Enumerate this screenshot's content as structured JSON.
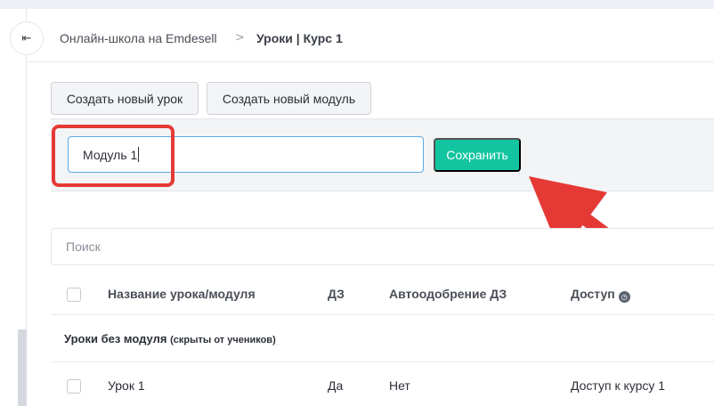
{
  "breadcrumb": {
    "school": "Онлайн-школа на Emdesell",
    "separator": ">",
    "current": "Уроки | Курс 1"
  },
  "toolbar": {
    "create_lesson": "Создать новый урок",
    "create_module": "Создать новый модуль"
  },
  "module_form": {
    "value": "Модуль 1",
    "save_label": "Сохранить"
  },
  "search": {
    "placeholder": "Поиск"
  },
  "table": {
    "columns": {
      "name": "Название урока/модуля",
      "hw": "ДЗ",
      "auto_approve": "Автоодобрение ДЗ",
      "access": "Доступ"
    },
    "groups": [
      {
        "title": "Уроки без модуля",
        "note": "(скрыты от учеников)",
        "rows": [
          {
            "name": "Урок 1",
            "hw": "Да",
            "auto_approve": "Нет",
            "access": "Доступ к курсу 1"
          }
        ]
      }
    ]
  },
  "icons": {
    "collapse": "collapse-sidebar-icon",
    "separator": "chevron-right-icon",
    "access_info": "clock-icon"
  },
  "colors": {
    "accent": "#12c4a0",
    "input_focus": "#5aa9e6",
    "annotation": "#e53935"
  }
}
